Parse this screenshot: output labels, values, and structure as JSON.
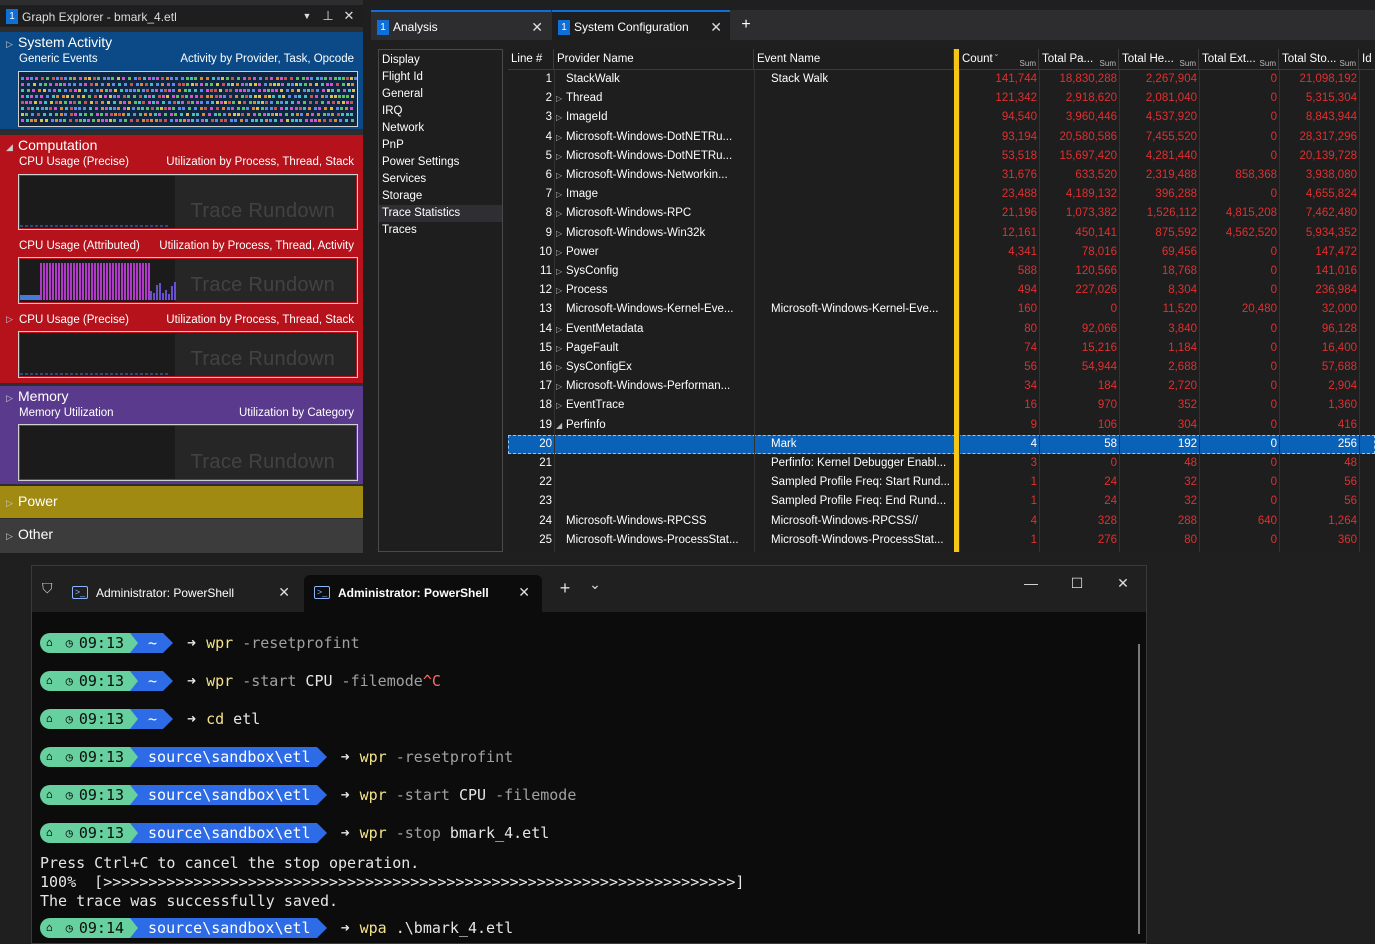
{
  "graph_explorer": {
    "title_num": "1",
    "title": "Graph Explorer - bmark_4.etl",
    "sections": {
      "system_activity": {
        "label": "System Activity",
        "sub_left": "Generic Events",
        "sub_right": "Activity by Provider, Task, Opcode"
      },
      "computation": {
        "label": "Computation"
      },
      "graph1": {
        "sub_left": "CPU Usage (Precise)",
        "sub_right": "Utilization by Process, Thread, Stack",
        "watermark": "Trace Rundown"
      },
      "graph2": {
        "sub_left": "CPU Usage (Attributed)",
        "sub_right": "Utilization by Process, Thread, Activity",
        "watermark": "Trace Rundown"
      },
      "graph3": {
        "sub_left": "CPU Usage (Precise)",
        "sub_right": "Utilization by Process, Thread, Stack",
        "watermark": "Trace Rundown"
      },
      "memory": {
        "label": "Memory",
        "sub_left": "Memory Utilization",
        "sub_right": "Utilization by Category",
        "watermark": "Trace Rundown"
      },
      "power": {
        "label": "Power"
      },
      "other": {
        "label": "Other"
      }
    },
    "colors": {
      "system_activity": "#0b4a86",
      "computation": "#b5121b",
      "memory": "#5a3a8c",
      "power": "#a08a12",
      "other": "#3c3c3c"
    }
  },
  "analysis": {
    "tab1_num": "1",
    "tab1": "Analysis",
    "tab2_num": "1",
    "tab2": "System Configuration",
    "add": "+",
    "left_list": [
      "Display",
      "Flight Id",
      "General",
      "IRQ",
      "Network",
      "PnP",
      "Power Settings",
      "Services",
      "Storage",
      "Trace Statistics",
      "Traces"
    ],
    "selected_left": "Trace Statistics",
    "headers": {
      "line": "Line #",
      "provider": "Provider Name",
      "event": "Event Name",
      "count": "Count",
      "pa": "Total Pa...",
      "he": "Total He...",
      "ext": "Total Ext...",
      "sto": "Total Sto...",
      "id": "Id",
      "sum": "Sum"
    },
    "rows": [
      {
        "line": "1",
        "tri": "",
        "provider": "StackWalk",
        "event": "Stack Walk",
        "count": "141,744",
        "pa": "18,830,288",
        "he": "2,267,904",
        "ext": "0",
        "sto": "21,098,192"
      },
      {
        "line": "2",
        "tri": "▷",
        "provider": "Thread",
        "event": "",
        "count": "121,342",
        "pa": "2,918,620",
        "he": "2,081,040",
        "ext": "0",
        "sto": "5,315,304"
      },
      {
        "line": "3",
        "tri": "▷",
        "provider": "ImageId",
        "event": "",
        "count": "94,540",
        "pa": "3,960,446",
        "he": "4,537,920",
        "ext": "0",
        "sto": "8,843,944"
      },
      {
        "line": "4",
        "tri": "▷",
        "provider": "Microsoft-Windows-DotNETRu...",
        "event": "",
        "count": "93,194",
        "pa": "20,580,586",
        "he": "7,455,520",
        "ext": "0",
        "sto": "28,317,296"
      },
      {
        "line": "5",
        "tri": "▷",
        "provider": "Microsoft-Windows-DotNETRu...",
        "event": "",
        "count": "53,518",
        "pa": "15,697,420",
        "he": "4,281,440",
        "ext": "0",
        "sto": "20,139,728"
      },
      {
        "line": "6",
        "tri": "▷",
        "provider": "Microsoft-Windows-Networkin...",
        "event": "",
        "count": "31,676",
        "pa": "633,520",
        "he": "2,319,488",
        "ext": "858,368",
        "sto": "3,938,080"
      },
      {
        "line": "7",
        "tri": "▷",
        "provider": "Image",
        "event": "",
        "count": "23,488",
        "pa": "4,189,132",
        "he": "396,288",
        "ext": "0",
        "sto": "4,655,824"
      },
      {
        "line": "8",
        "tri": "▷",
        "provider": "Microsoft-Windows-RPC",
        "event": "",
        "count": "21,196",
        "pa": "1,073,382",
        "he": "1,526,112",
        "ext": "4,815,208",
        "sto": "7,462,480"
      },
      {
        "line": "9",
        "tri": "▷",
        "provider": "Microsoft-Windows-Win32k",
        "event": "",
        "count": "12,161",
        "pa": "450,141",
        "he": "875,592",
        "ext": "4,562,520",
        "sto": "5,934,352"
      },
      {
        "line": "10",
        "tri": "▷",
        "provider": "Power",
        "event": "",
        "count": "4,341",
        "pa": "78,016",
        "he": "69,456",
        "ext": "0",
        "sto": "147,472"
      },
      {
        "line": "11",
        "tri": "▷",
        "provider": "SysConfig",
        "event": "",
        "count": "588",
        "pa": "120,566",
        "he": "18,768",
        "ext": "0",
        "sto": "141,016"
      },
      {
        "line": "12",
        "tri": "▷",
        "provider": "Process",
        "event": "",
        "count": "494",
        "pa": "227,026",
        "he": "8,304",
        "ext": "0",
        "sto": "236,984"
      },
      {
        "line": "13",
        "tri": "",
        "provider": "Microsoft-Windows-Kernel-Eve...",
        "event": "Microsoft-Windows-Kernel-Eve...",
        "count": "160",
        "pa": "0",
        "he": "11,520",
        "ext": "20,480",
        "sto": "32,000"
      },
      {
        "line": "14",
        "tri": "▷",
        "provider": "EventMetadata",
        "event": "",
        "count": "80",
        "pa": "92,066",
        "he": "3,840",
        "ext": "0",
        "sto": "96,128"
      },
      {
        "line": "15",
        "tri": "▷",
        "provider": "PageFault",
        "event": "",
        "count": "74",
        "pa": "15,216",
        "he": "1,184",
        "ext": "0",
        "sto": "16,400"
      },
      {
        "line": "16",
        "tri": "▷",
        "provider": "SysConfigEx",
        "event": "",
        "count": "56",
        "pa": "54,944",
        "he": "2,688",
        "ext": "0",
        "sto": "57,688"
      },
      {
        "line": "17",
        "tri": "▷",
        "provider": "Microsoft-Windows-Performan...",
        "event": "",
        "count": "34",
        "pa": "184",
        "he": "2,720",
        "ext": "0",
        "sto": "2,904"
      },
      {
        "line": "18",
        "tri": "▷",
        "provider": "EventTrace",
        "event": "",
        "count": "16",
        "pa": "970",
        "he": "352",
        "ext": "0",
        "sto": "1,360"
      },
      {
        "line": "19",
        "tri": "◢",
        "provider": "Perfinfo",
        "event": "",
        "count": "9",
        "pa": "106",
        "he": "304",
        "ext": "0",
        "sto": "416"
      },
      {
        "line": "20",
        "tri": "",
        "provider": "",
        "event": "Mark",
        "count": "4",
        "pa": "58",
        "he": "192",
        "ext": "0",
        "sto": "256"
      },
      {
        "line": "21",
        "tri": "",
        "provider": "",
        "event": "Perfinfo: Kernel Debugger Enabl...",
        "count": "3",
        "pa": "0",
        "he": "48",
        "ext": "0",
        "sto": "48"
      },
      {
        "line": "22",
        "tri": "",
        "provider": "",
        "event": "Sampled Profile Freq: Start Rund...",
        "count": "1",
        "pa": "24",
        "he": "32",
        "ext": "0",
        "sto": "56"
      },
      {
        "line": "23",
        "tri": "",
        "provider": "",
        "event": "Sampled Profile Freq: End Rund...",
        "count": "1",
        "pa": "24",
        "he": "32",
        "ext": "0",
        "sto": "56"
      },
      {
        "line": "24",
        "tri": "",
        "provider": "Microsoft-Windows-RPCSS",
        "event": "Microsoft-Windows-RPCSS//",
        "count": "4",
        "pa": "328",
        "he": "288",
        "ext": "640",
        "sto": "1,264"
      },
      {
        "line": "25",
        "tri": "",
        "provider": "Microsoft-Windows-ProcessStat...",
        "event": "Microsoft-Windows-ProcessStat...",
        "count": "1",
        "pa": "276",
        "he": "80",
        "ext": "0",
        "sto": "360"
      }
    ],
    "selected_row": "20"
  },
  "terminal": {
    "tab1": "Administrator: PowerShell",
    "tab2": "Administrator: PowerShell",
    "add": "+",
    "dropdown": "⌄",
    "minimize": "—",
    "maximize": "☐",
    "close": "✕",
    "lines": [
      {
        "type": "prompt",
        "time": "09:13",
        "path": "~",
        "cmd_k": "wpr",
        "cmd_args": " -resetprofint",
        "cmd_b": "",
        "cmd_r": ""
      },
      {
        "type": "prompt",
        "time": "09:13",
        "path": "~",
        "cmd_k": "wpr",
        "cmd_args": " -start",
        "cmd_b": " CPU",
        "cmd_args2": " -filemode",
        "cmd_r": "^C"
      },
      {
        "type": "prompt",
        "time": "09:13",
        "path": "~",
        "cmd_k": "cd",
        "cmd_args": "",
        "cmd_b": " etl",
        "cmd_r": ""
      },
      {
        "type": "prompt",
        "time": "09:13",
        "path": "source\\sandbox\\etl",
        "cmd_k": "wpr",
        "cmd_args": " -resetprofint",
        "cmd_b": "",
        "cmd_r": ""
      },
      {
        "type": "prompt",
        "time": "09:13",
        "path": "source\\sandbox\\etl",
        "cmd_k": "wpr",
        "cmd_args": " -start",
        "cmd_b": " CPU",
        "cmd_args2": " -filemode",
        "cmd_r": ""
      },
      {
        "type": "prompt",
        "time": "09:13",
        "path": "source\\sandbox\\etl",
        "cmd_k": "wpr",
        "cmd_args": " -stop",
        "cmd_b": " bmark_4.etl",
        "cmd_r": ""
      },
      {
        "type": "text",
        "text": "Press Ctrl+C to cancel the stop operation."
      },
      {
        "type": "text",
        "text": "100%  [>>>>>>>>>>>>>>>>>>>>>>>>>>>>>>>>>>>>>>>>>>>>>>>>>>>>>>>>>>>>>>>>>>>>>>]"
      },
      {
        "type": "text",
        "text": "The trace was successfully saved."
      },
      {
        "type": "prompt",
        "time": "09:14",
        "path": "source\\sandbox\\etl",
        "cmd_k": "wpa",
        "cmd_args": "",
        "cmd_b": " .\\bmark_4.etl",
        "cmd_r": ""
      }
    ],
    "icons": {
      "shield": "shield-icon",
      "ps": "powershell-icon",
      "home": "home-icon",
      "clock": "clock-icon"
    },
    "colors": {
      "prompt_green": "#66d19e",
      "prompt_blue": "#2e6be6",
      "command": "#f4e38a"
    }
  }
}
